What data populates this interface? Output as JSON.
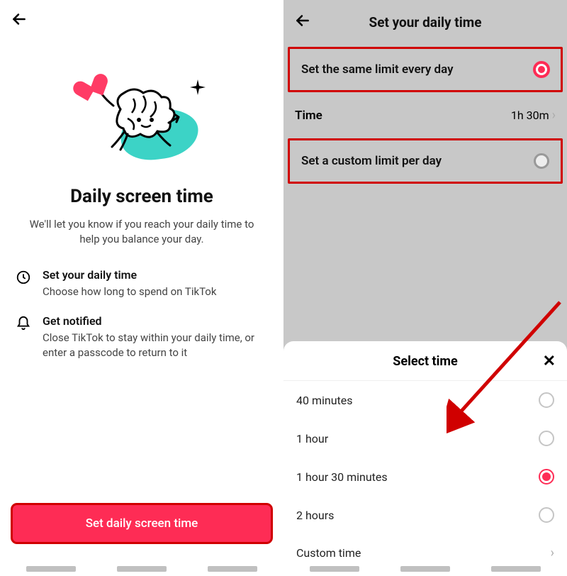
{
  "left": {
    "title": "Daily screen time",
    "subtitle": "We'll let you know if you reach your daily time to help you balance your day.",
    "features": [
      {
        "title": "Set your daily time",
        "desc": "Choose how long to spend on TikTok"
      },
      {
        "title": "Get notified",
        "desc": "Close TikTok to stay within your daily time, or enter a passcode to return to it"
      }
    ],
    "cta": "Set daily screen time"
  },
  "right": {
    "title": "Set your daily time",
    "option_same": "Set the same limit every day",
    "time_label": "Time",
    "time_value": "1h 30m",
    "option_custom": "Set a custom limit per day"
  },
  "sheet": {
    "title": "Select time",
    "options": [
      {
        "label": "40 minutes",
        "selected": false
      },
      {
        "label": "1 hour",
        "selected": false
      },
      {
        "label": "1 hour 30 minutes",
        "selected": true
      },
      {
        "label": "2 hours",
        "selected": false
      }
    ],
    "custom_label": "Custom time"
  },
  "colors": {
    "accent": "#fe2c55",
    "highlight_border": "#d00000"
  }
}
